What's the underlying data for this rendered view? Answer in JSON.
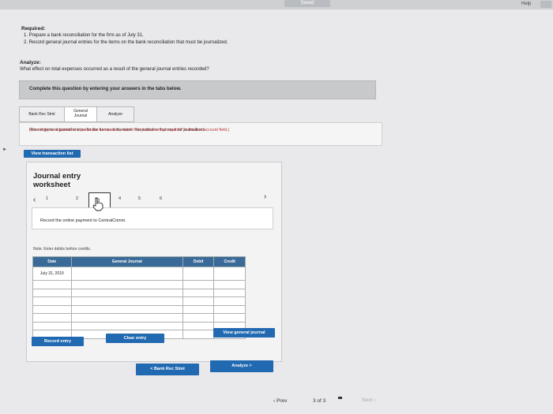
{
  "topbar": {
    "saved_label": "Saved",
    "help_label": "Help"
  },
  "required": {
    "title": "Required:",
    "items": [
      "1. Prepare a bank reconciliation for the firm as of July 31.",
      "2. Record general journal entries for the items on the bank reconciliation that must be journalized."
    ]
  },
  "analyze": {
    "title": "Analyze:",
    "question": "What effect on total expenses occurred as a result of the general journal entries recorded?"
  },
  "instruction": "Complete this question by entering your answers in the tabs below.",
  "tabs": [
    {
      "line1": "Bank Rec Stmt",
      "line2": ""
    },
    {
      "line1": "General",
      "line2": "Journal"
    },
    {
      "line1": "Analyze",
      "line2": ""
    }
  ],
  "panel_note": {
    "text": "Record general journal entries for the items on the bank reconciliation that must be journalized.",
    "red_text": "(If no entry is required for a particular transaction, select \"No journal entry required\" in the first account field.)"
  },
  "view_transaction_list": "View transaction list",
  "worksheet": {
    "title": "Journal entry worksheet",
    "pages": [
      "1",
      "2",
      "3",
      "4",
      "5",
      "6"
    ],
    "active_page": "3",
    "description": "Record the online payment to CentralComm.",
    "note": "Note: Enter debits before credits.",
    "columns": [
      "Date",
      "General Journal",
      "Debit",
      "Credit"
    ],
    "rows": [
      {
        "date": "July 31, 2019",
        "account": "",
        "debit": "",
        "credit": ""
      },
      {
        "date": "",
        "account": "",
        "debit": "",
        "credit": ""
      },
      {
        "date": "",
        "account": "",
        "debit": "",
        "credit": ""
      },
      {
        "date": "",
        "account": "",
        "debit": "",
        "credit": ""
      },
      {
        "date": "",
        "account": "",
        "debit": "",
        "credit": ""
      },
      {
        "date": "",
        "account": "",
        "debit": "",
        "credit": ""
      },
      {
        "date": "",
        "account": "",
        "debit": "",
        "credit": ""
      },
      {
        "date": "",
        "account": "",
        "debit": "",
        "credit": ""
      }
    ],
    "record_entry": "Record entry",
    "clear_entry": "Clear entry",
    "view_general_journal": "View general journal"
  },
  "nav": {
    "prev_tab": "< Bank Rec Stmt",
    "next_tab": "Analyze >"
  },
  "footer": {
    "prev": "Prev",
    "page": "3 of 3",
    "next": "Next"
  },
  "colors": {
    "accent": "#2169b0",
    "table_header": "#3a6a98"
  }
}
